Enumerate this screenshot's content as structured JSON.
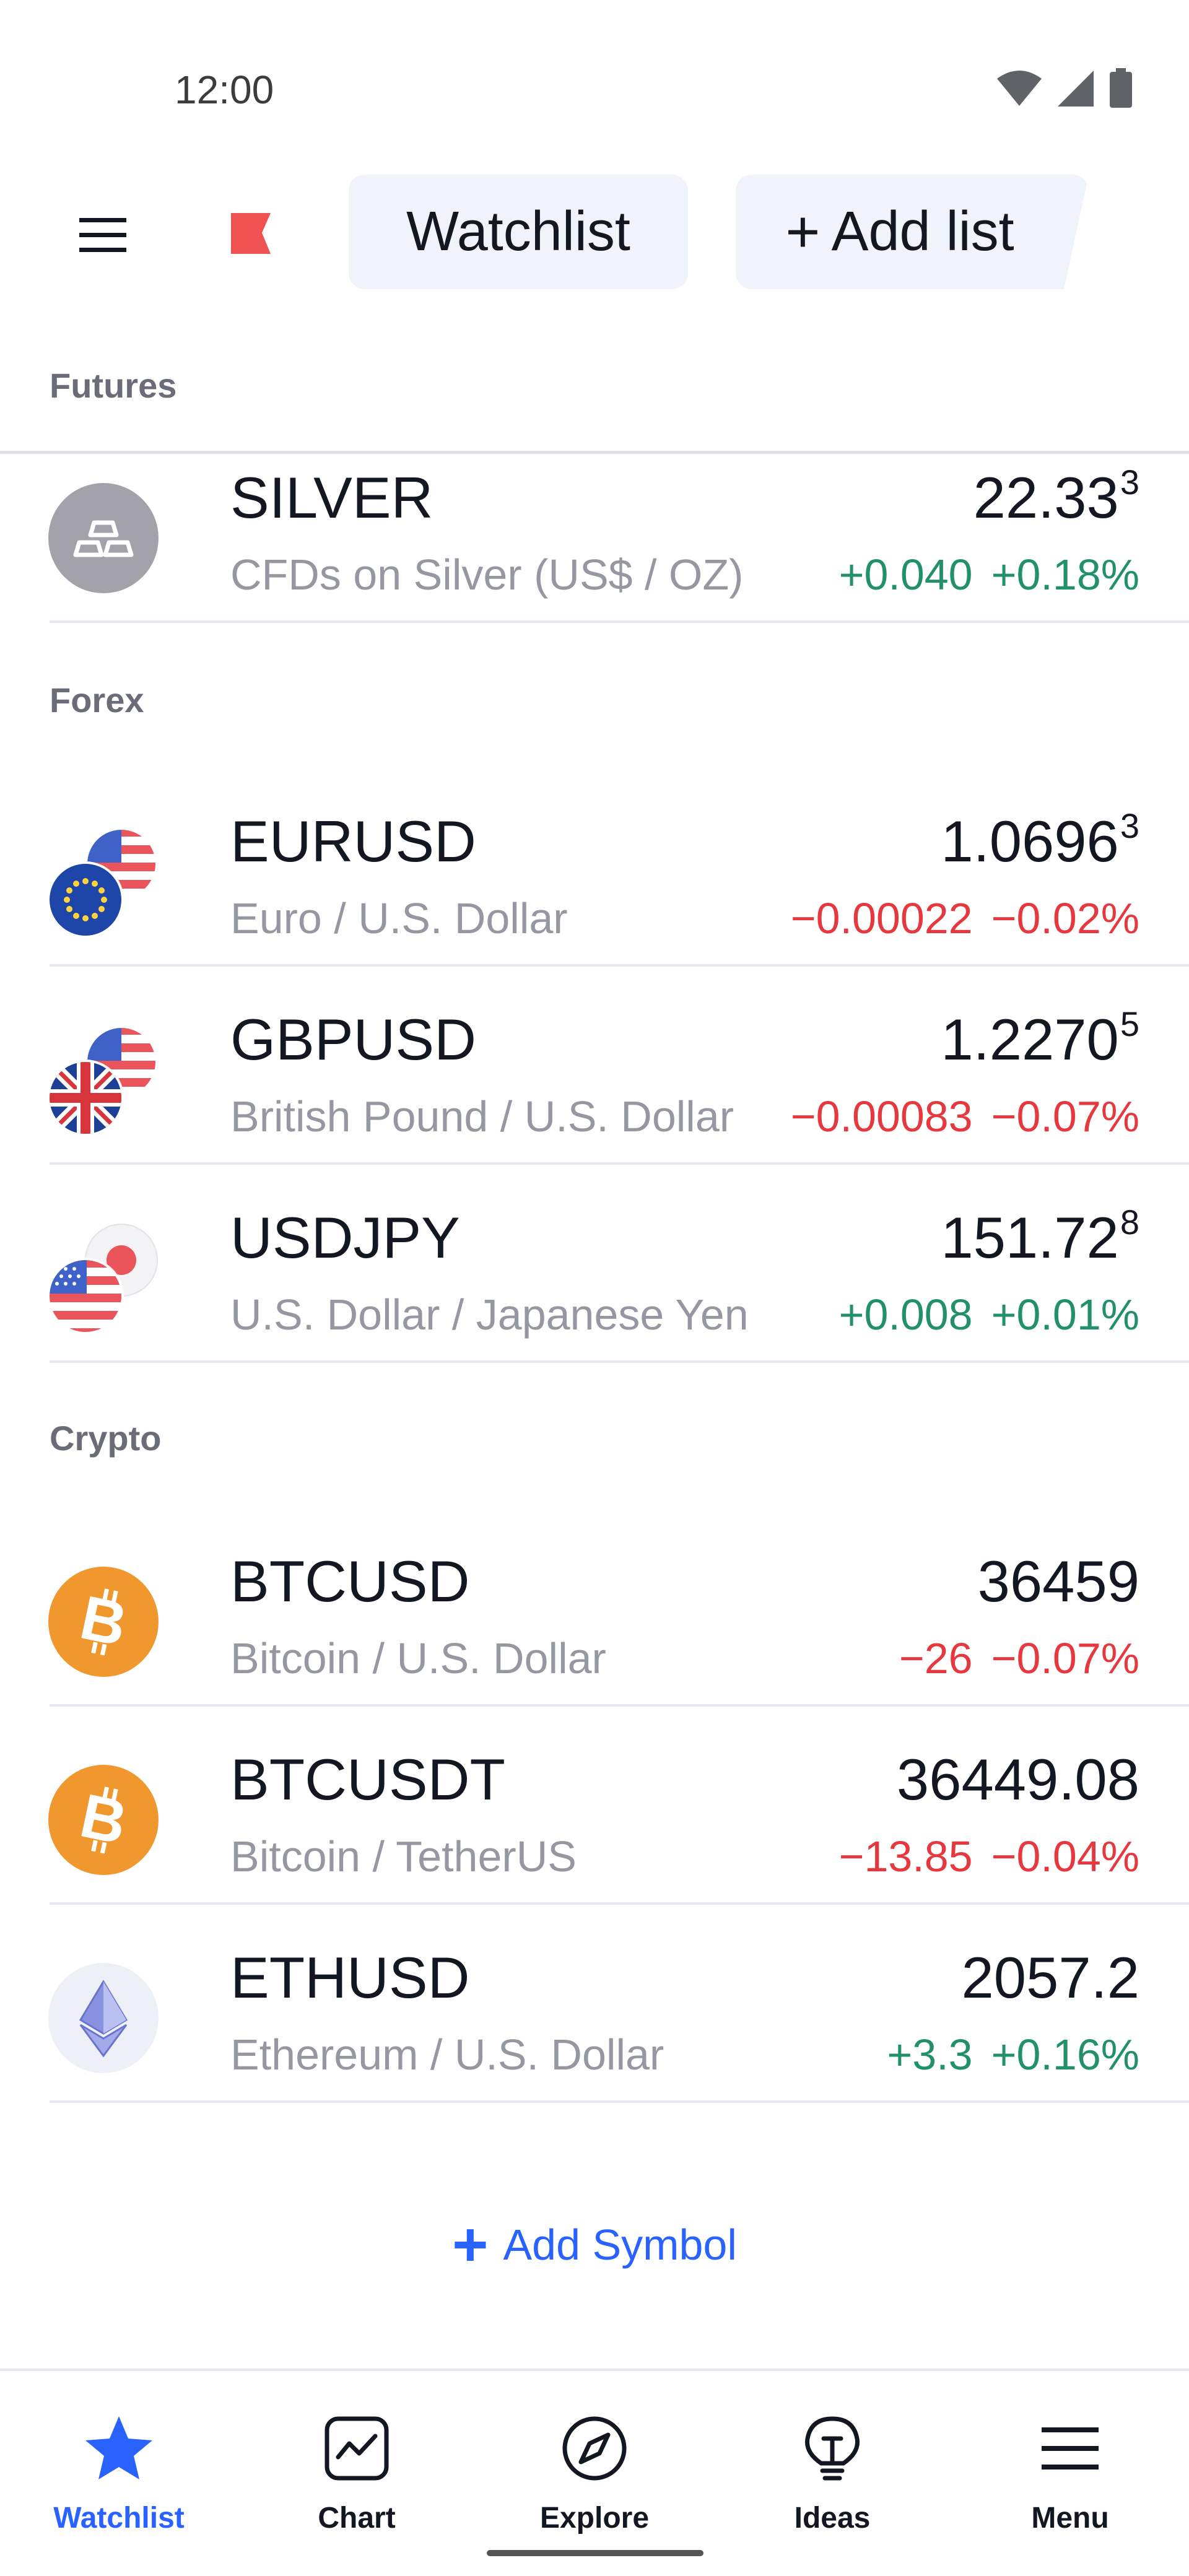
{
  "status_bar": {
    "time": "12:00"
  },
  "header": {
    "tabs": [
      {
        "label": "Watchlist"
      },
      {
        "label": "Add list",
        "prefix": "+"
      }
    ]
  },
  "sections": [
    {
      "title": "Futures",
      "rows": [
        {
          "symbol": "SILVER",
          "description": "CFDs on Silver (US$ / OZ)",
          "price_main": "22.33",
          "price_sup": "3",
          "change": "+0.040",
          "change_pct": "+0.18%",
          "direction": "up",
          "logo": "silver-bars-icon"
        }
      ]
    },
    {
      "title": "Forex",
      "rows": [
        {
          "symbol": "EURUSD",
          "description": "Euro / U.S. Dollar",
          "price_main": "1.0696",
          "price_sup": "3",
          "change": "−0.00022",
          "change_pct": "−0.02%",
          "direction": "down",
          "logo": "eu-us-flags-icon"
        },
        {
          "symbol": "GBPUSD",
          "description": "British Pound / U.S. Dollar",
          "price_main": "1.2270",
          "price_sup": "5",
          "change": "−0.00083",
          "change_pct": "−0.07%",
          "direction": "down",
          "logo": "uk-us-flags-icon"
        },
        {
          "symbol": "USDJPY",
          "description": "U.S. Dollar / Japanese Yen",
          "price_main": "151.72",
          "price_sup": "8",
          "change": "+0.008",
          "change_pct": "+0.01%",
          "direction": "up",
          "logo": "us-jp-flags-icon"
        }
      ]
    },
    {
      "title": "Crypto",
      "rows": [
        {
          "symbol": "BTCUSD",
          "description": "Bitcoin / U.S. Dollar",
          "price_main": "36459",
          "price_sup": "",
          "change": "−26",
          "change_pct": "−0.07%",
          "direction": "down",
          "logo": "bitcoin-icon"
        },
        {
          "symbol": "BTCUSDT",
          "description": "Bitcoin / TetherUS",
          "price_main": "36449.08",
          "price_sup": "",
          "change": "−13.85",
          "change_pct": "−0.04%",
          "direction": "down",
          "logo": "bitcoin-icon"
        },
        {
          "symbol": "ETHUSD",
          "description": "Ethereum / U.S. Dollar",
          "price_main": "2057.2",
          "price_sup": "",
          "change": "+3.3",
          "change_pct": "+0.16%",
          "direction": "up",
          "logo": "ethereum-icon"
        }
      ]
    }
  ],
  "add_symbol": {
    "prefix": "+",
    "label": "Add Symbol"
  },
  "bottom_nav": [
    {
      "label": "Watchlist",
      "icon": "star-icon",
      "active": true
    },
    {
      "label": "Chart",
      "icon": "chart-icon",
      "active": false
    },
    {
      "label": "Explore",
      "icon": "compass-icon",
      "active": false
    },
    {
      "label": "Ideas",
      "icon": "lightbulb-icon",
      "active": false
    },
    {
      "label": "Menu",
      "icon": "menu-icon",
      "active": false
    }
  ],
  "colors": {
    "accent": "#2962ff",
    "positive": "#22916a",
    "negative": "#e5393f",
    "bitcoin": "#f0972e"
  }
}
